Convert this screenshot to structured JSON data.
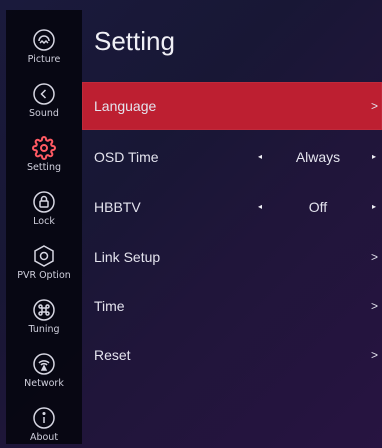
{
  "page": {
    "title": "Setting"
  },
  "sidebar": {
    "items": [
      {
        "label": "Picture",
        "icon": "picture-icon"
      },
      {
        "label": "Sound",
        "icon": "sound-icon"
      },
      {
        "label": "Setting",
        "icon": "gear-icon"
      },
      {
        "label": "Lock",
        "icon": "lock-icon"
      },
      {
        "label": "PVR Option",
        "icon": "record-icon"
      },
      {
        "label": "Tuning",
        "icon": "tuning-icon"
      },
      {
        "label": "Network",
        "icon": "network-icon"
      },
      {
        "label": "About",
        "icon": "info-icon"
      }
    ]
  },
  "menu": {
    "rows": [
      {
        "label": "Language",
        "arrow": ">"
      },
      {
        "label": "OSD Time",
        "left": "◂",
        "value": "Always",
        "right": "▸"
      },
      {
        "label": "HBBTV",
        "left": "◂",
        "value": "Off",
        "right": "▸"
      },
      {
        "label": "Link Setup",
        "arrow": ">"
      },
      {
        "label": "Time",
        "arrow": ">"
      },
      {
        "label": "Reset",
        "arrow": ">"
      }
    ]
  },
  "colors": {
    "accent": "#bd1f31",
    "active_icon": "#ff5a63"
  }
}
